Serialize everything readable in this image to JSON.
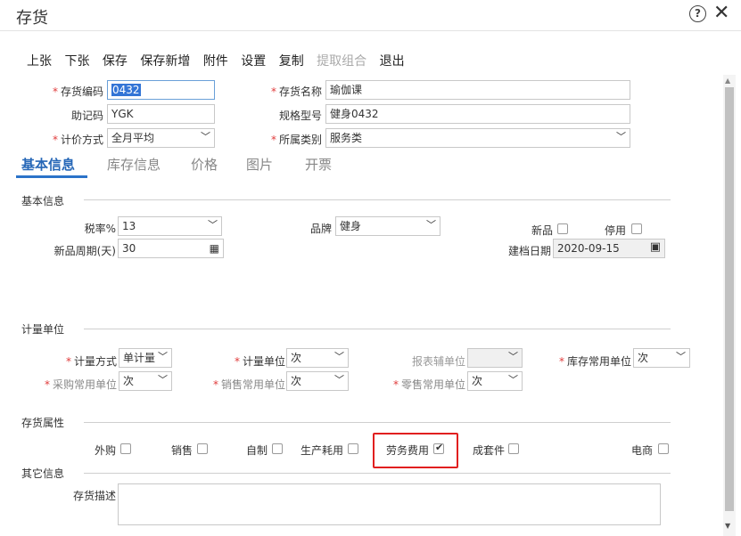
{
  "window": {
    "title": "存货",
    "help_icon": "?",
    "close_icon": "✕"
  },
  "toolbar": {
    "items": [
      "上张",
      "下张",
      "保存",
      "保存新增",
      "附件",
      "设置",
      "复制",
      "提取组合",
      "退出"
    ],
    "disabled_index": 7
  },
  "header_fields": {
    "code_label": "存货编码",
    "code_value": "0432",
    "name_label": "存货名称",
    "name_value": "瑜伽课",
    "mnemonic_label": "助记码",
    "mnemonic_value": "YGK",
    "spec_label": "规格型号",
    "spec_value": "健身0432",
    "pricing_label": "计价方式",
    "pricing_value": "全月平均",
    "category_label": "所属类别",
    "category_value": "服务类"
  },
  "tabs": [
    "基本信息",
    "库存信息",
    "价格",
    "图片",
    "开票"
  ],
  "basic_info": {
    "section_title": "基本信息",
    "tax_label": "税率%",
    "tax_value": "13",
    "brand_label": "品牌",
    "brand_value": "健身",
    "new_label": "新品",
    "disabled_label": "停用",
    "new_period_label": "新品周期(天)",
    "new_period_value": "30",
    "create_date_label": "建档日期",
    "create_date_value": "2020-09-15"
  },
  "units": {
    "section_title": "计量单位",
    "method_label": "计量方式",
    "method_value": "单计量",
    "unit_label": "计量单位",
    "unit_value": "次",
    "report_unit_label": "报表辅单位",
    "stock_unit_label": "库存常用单位",
    "stock_unit_value": "次",
    "purchase_unit_label": "采购常用单位",
    "purchase_unit_value": "次",
    "sales_unit_label": "销售常用单位",
    "sales_unit_value": "次",
    "retail_unit_label": "零售常用单位",
    "retail_unit_value": "次"
  },
  "attributes": {
    "section_title": "存货属性",
    "outsource": "外购",
    "sales": "销售",
    "self_made": "自制",
    "production_use": "生产耗用",
    "labor_cost": "劳务费用",
    "kit": "成套件",
    "ecommerce": "电商"
  },
  "other": {
    "section_title": "其它信息",
    "desc_label": "存货描述"
  },
  "colors": {
    "accent": "#2b73c9",
    "highlight": "#e11f1f",
    "required": "#e03c3c"
  }
}
